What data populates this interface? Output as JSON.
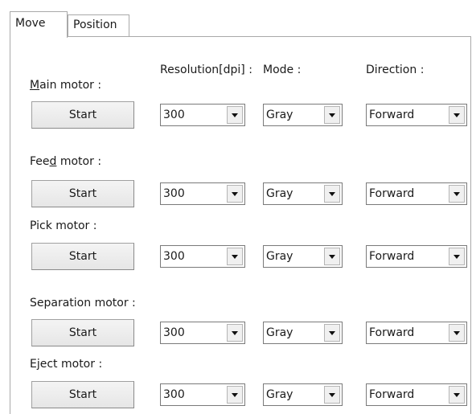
{
  "tabs": [
    {
      "label": "Move",
      "active": true
    },
    {
      "label": "Position",
      "active": false
    }
  ],
  "headers": {
    "resolution": "Resolution[dpi] :",
    "mode": "Mode :",
    "direction": "Direction :"
  },
  "motors": [
    {
      "label_pre": "",
      "label_ul": "M",
      "label_post": "ain motor :",
      "button": "Start",
      "resolution": "300",
      "mode": "Gray",
      "direction": "Forward"
    },
    {
      "label_pre": "Fee",
      "label_ul": "d",
      "label_post": " motor :",
      "button": "Start",
      "resolution": "300",
      "mode": "Gray",
      "direction": "Forward"
    },
    {
      "label_pre": "Pick motor :",
      "label_ul": "",
      "label_post": "",
      "button": "Start",
      "resolution": "300",
      "mode": "Gray",
      "direction": "Forward"
    },
    {
      "label_pre": "Separation motor :",
      "label_ul": "",
      "label_post": "",
      "button": "Start",
      "resolution": "300",
      "mode": "Gray",
      "direction": "Forward"
    },
    {
      "label_pre": "Eject motor :",
      "label_ul": "",
      "label_post": "",
      "button": "Start",
      "resolution": "300",
      "mode": "Gray",
      "direction": "Forward"
    }
  ],
  "icons": {
    "dropdown": "chevron-down-icon"
  }
}
